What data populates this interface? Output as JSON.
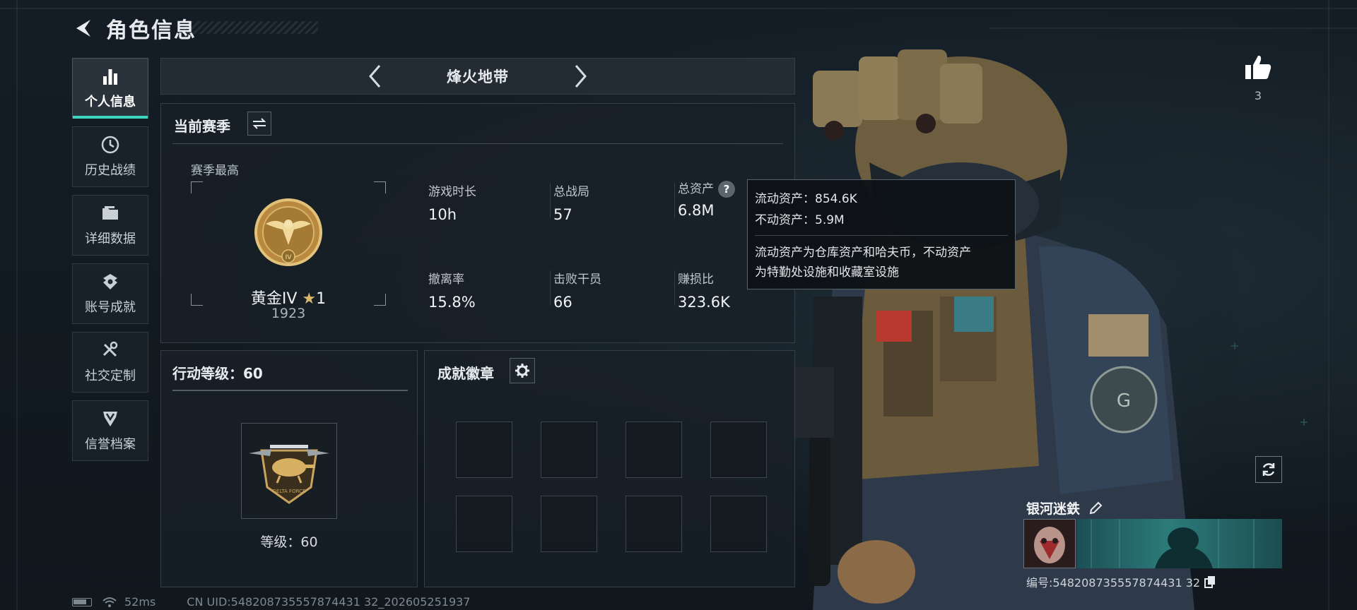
{
  "header": {
    "title": "角色信息"
  },
  "sidebar": {
    "items": [
      {
        "label": "个人信息",
        "icon": "bar-chart-icon",
        "active": true
      },
      {
        "label": "历史战绩",
        "icon": "history-clock-icon"
      },
      {
        "label": "详细数据",
        "icon": "folder-icon"
      },
      {
        "label": "账号成就",
        "icon": "achievement-medal-icon"
      },
      {
        "label": "社交定制",
        "icon": "tools-icon"
      },
      {
        "label": "信誉档案",
        "icon": "shield-rank-icon"
      }
    ]
  },
  "mode": {
    "name": "烽火地带"
  },
  "season": {
    "title": "当前赛季",
    "best_label": "赛季最高",
    "rank_name": "黄金IV",
    "rank_stars": "1",
    "rank_score": "1923",
    "stats": [
      {
        "label": "游戏时长",
        "value": "10h"
      },
      {
        "label": "总战局",
        "value": "57"
      },
      {
        "label": "总资产",
        "value": "6.8M"
      },
      {
        "label": "撤离率",
        "value": "15.8%"
      },
      {
        "label": "击败干员",
        "value": "66"
      },
      {
        "label": "赚损比",
        "value": "323.6K"
      }
    ],
    "help_glyph": "?"
  },
  "tooltip": {
    "liquid": "流动资产：854.6K",
    "fixed": "不动资产：5.9M",
    "desc_line1": "流动资产为仓库资产和哈夫币，不动资产",
    "desc_line2": "为特勤处设施和收藏室设施"
  },
  "level": {
    "title": "行动等级：60",
    "badge_text": "DELTA FORCE",
    "level_text": "等级：60"
  },
  "achievements": {
    "title": "成就徽章",
    "slots": 8
  },
  "footer": {
    "ping": "52ms",
    "uid": "CN UID:548208735557874431 32_202605251937"
  },
  "player": {
    "likes": "3",
    "name": "银河迷鉄",
    "id": "编号:548208735557874431 32"
  },
  "colors": {
    "accent": "#3bd4c0",
    "panel": "#182027",
    "gold": "#c9a35a"
  }
}
